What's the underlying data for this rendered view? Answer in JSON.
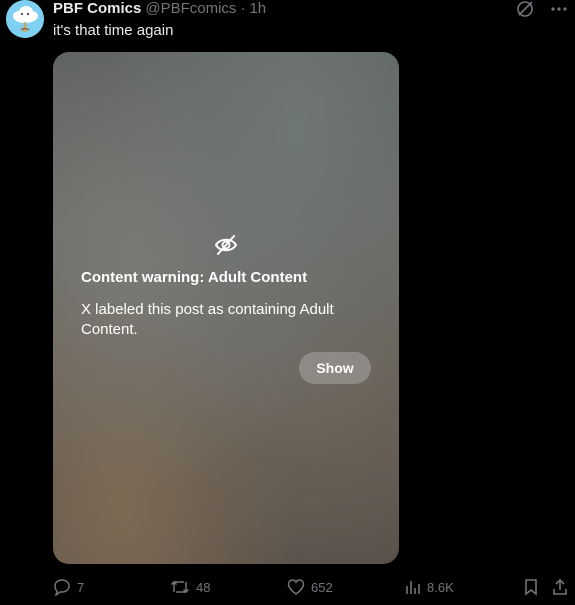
{
  "tweet": {
    "author_name": "PBF Comics",
    "handle": "@PBFcomics",
    "separator": "·",
    "time": "1h",
    "text": "it's that time again"
  },
  "content_warning": {
    "icon": "eye-slash-icon",
    "title": "Content warning: Adult Content",
    "body": "X labeled this post as containing Adult Content.",
    "show_label": "Show"
  },
  "actions": {
    "replies": "7",
    "reposts": "48",
    "likes": "652",
    "views": "8.6K"
  },
  "colors": {
    "background": "#000000",
    "text": "#e7e9ea",
    "muted": "#71767b",
    "avatar": "#7fd0f2"
  }
}
